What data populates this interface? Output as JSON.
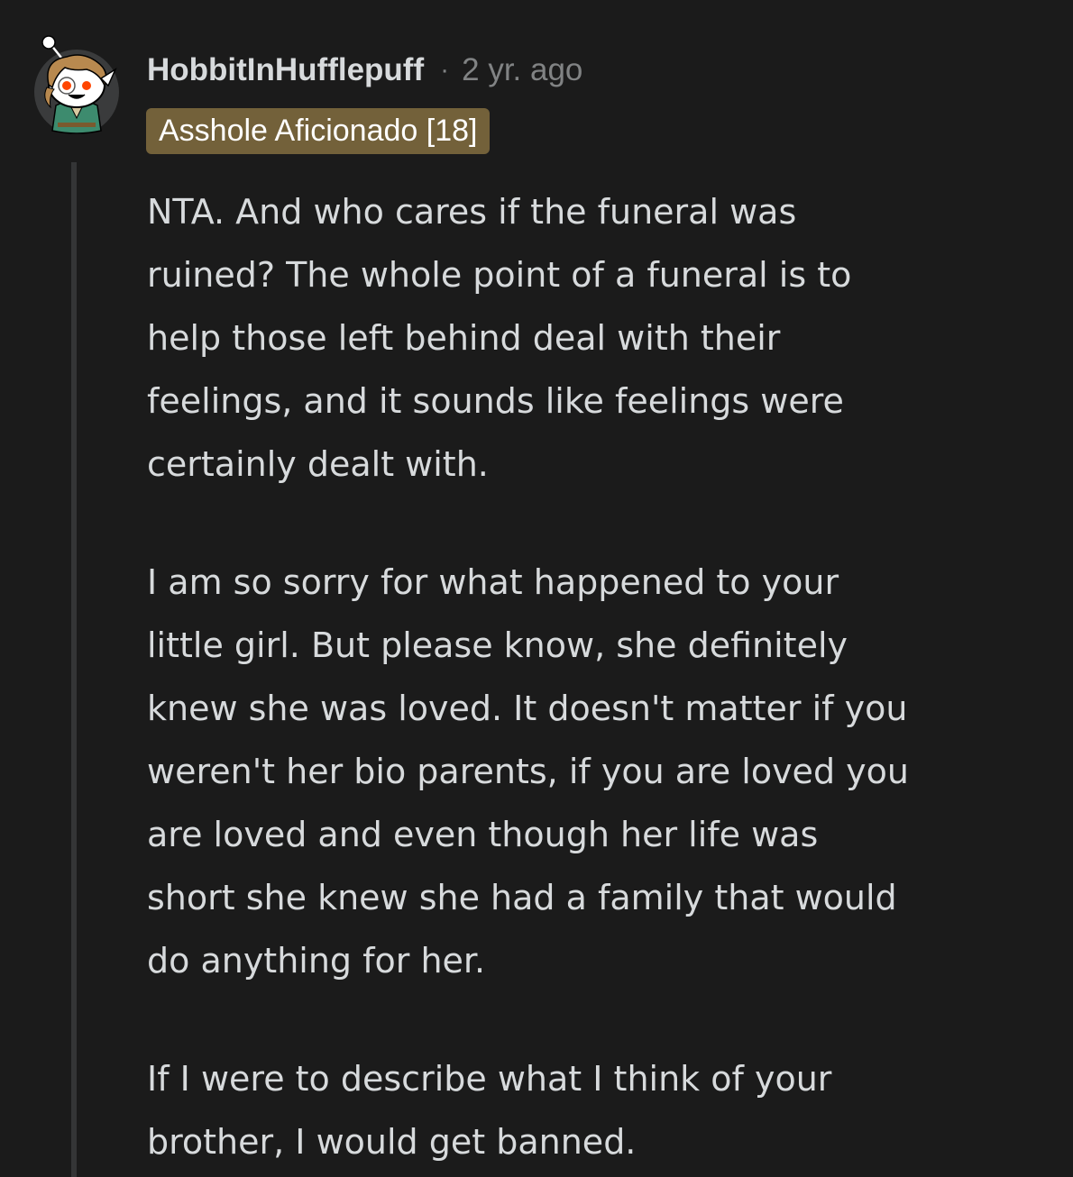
{
  "comment": {
    "author": "HobbitInHufflepuff",
    "separator": "·",
    "timestamp": "2 yr. ago",
    "flair": "Asshole Aficionado [18]",
    "colors": {
      "background": "#1b1b1b",
      "text": "#d7dadc",
      "muted": "#818384",
      "flair_background": "#73613a",
      "thread_line": "#343536"
    },
    "avatar_icon": "snoo-avatar-icon",
    "paragraphs": [
      "NTA. And who cares if the funeral was\nruined? The whole point of a funeral is to\nhelp those left behind deal with their\nfeelings, and it sounds like feelings were\ncertainly dealt with.",
      "I am so sorry for what happened to your\nlittle girl. But please know, she definitely\nknew she was loved. It doesn't matter if you\nweren't her bio parents, if you are loved you\nare loved and even though her life was\nshort she knew she had a family that would\ndo anything for her.",
      "If I were to describe what I think of your\nbrother, I would get banned."
    ]
  }
}
